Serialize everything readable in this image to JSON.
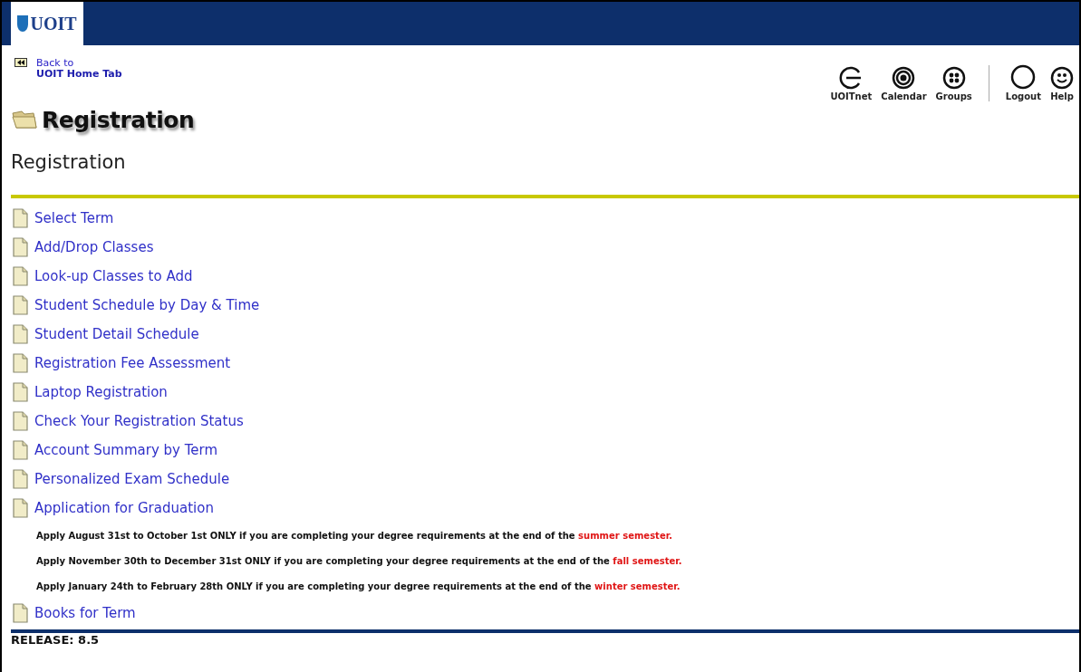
{
  "header": {
    "logo": "UOIT"
  },
  "back_link": {
    "line1": "Back to",
    "line2": "UOIT Home Tab"
  },
  "toolbar": [
    {
      "label": "UOITnet",
      "kind": "arc"
    },
    {
      "label": "Calendar",
      "kind": "target"
    },
    {
      "label": "Groups",
      "kind": "dots"
    },
    {
      "label": "Logout",
      "kind": "ring"
    },
    {
      "label": "Help",
      "kind": "smile"
    }
  ],
  "banner_title": "Registration",
  "page_title": "Registration",
  "links": [
    "Select Term",
    "Add/Drop Classes",
    "Look-up Classes to Add",
    "Student Schedule by Day & Time",
    "Student Detail Schedule",
    "Registration Fee Assessment",
    "Laptop Registration",
    "Check Your Registration Status",
    "Account Summary by Term",
    "Personalized Exam Schedule",
    "Application for Graduation"
  ],
  "notes": [
    {
      "text": "Apply August 31st to October 1st ONLY if you are completing your degree requirements at the end of the ",
      "highlight": "summer semester."
    },
    {
      "text": "Apply November 30th to December 31st ONLY if you are completing your degree requirements at the end of the ",
      "highlight": "fall semester."
    },
    {
      "text": "Apply January 24th to February 28th ONLY if you are completing your degree requirements at the end of the ",
      "highlight": "winter semester."
    }
  ],
  "after_links": [
    "Books for Term"
  ],
  "release": "RELEASE: 8.5"
}
